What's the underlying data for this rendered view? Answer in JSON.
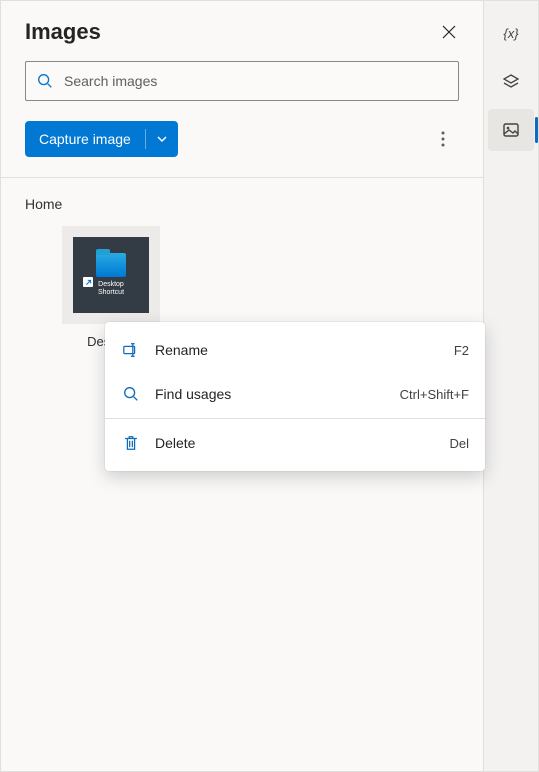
{
  "header": {
    "title": "Images"
  },
  "search": {
    "placeholder": "Search images"
  },
  "toolbar": {
    "capture_label": "Capture image"
  },
  "section": {
    "label": "Home"
  },
  "item": {
    "caption": "Desktop",
    "thumb_text_line1": "Desktop",
    "thumb_text_line2": "Shortcut"
  },
  "context_menu": {
    "items": [
      {
        "icon": "rename-icon",
        "label": "Rename",
        "shortcut": "F2"
      },
      {
        "icon": "search-icon",
        "label": "Find usages",
        "shortcut": "Ctrl+Shift+F"
      },
      {
        "icon": "delete-icon",
        "label": "Delete",
        "shortcut": "Del"
      }
    ]
  },
  "rail": {
    "items": [
      {
        "icon": "variables-icon",
        "active": false
      },
      {
        "icon": "layers-icon",
        "active": false
      },
      {
        "icon": "images-icon",
        "active": true
      }
    ]
  }
}
